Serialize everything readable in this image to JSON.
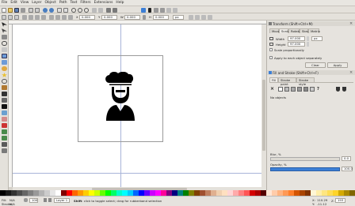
{
  "menu": [
    "File",
    "Edit",
    "View",
    "Layer",
    "Object",
    "Path",
    "Text",
    "Filters",
    "Extensions",
    "Help"
  ],
  "toolbar": {
    "x_label": "X",
    "x_value": "0.000",
    "y_label": "Y",
    "y_value": "0.000",
    "w_label": "W",
    "w_value": "0.000",
    "h_label": "H",
    "h_value": "0.000",
    "unit": "px"
  },
  "transform_panel": {
    "title": "Transform (Shift+Ctrl+M)",
    "tabs": [
      "Move",
      "Scale",
      "Rotate",
      "Skew",
      "Matrix"
    ],
    "active_tab": "Scale",
    "width_label": "Width",
    "width_value": "97.000",
    "height_label": "Height",
    "height_value": "97.000",
    "unit": "px",
    "scale_proportionally": "Scale proportionally",
    "apply_separately": "Apply to each object separately",
    "clear": "Clear",
    "apply": "Apply"
  },
  "fill_stroke_panel": {
    "title": "Fill and Stroke (Shift+Ctrl+F)",
    "tabs": [
      "Fill",
      "Stroke paint",
      "Stroke style"
    ],
    "active_tab": "Fill",
    "message": "No objects",
    "x_mark": "×",
    "question_mark": "?",
    "blur_label": "Blur, %",
    "blur_value": "0.0",
    "opacity_label": "Opacity, %",
    "opacity_value": "100.0"
  },
  "status": {
    "fill_label": "Fill:",
    "fill_value": "N/A",
    "stroke_label": "Stroke:",
    "stroke_value": "N/A",
    "opacity_value": "100",
    "layer": "Layer 1",
    "message_bold": "Shift",
    "message_rest": ": click to toggle select; drag for rubberband selection",
    "x_label": "X:",
    "x_value": "110.29",
    "y_label": "Y:",
    "y_value": "-11.12",
    "zoom_label": "Z:",
    "zoom_value": "193"
  },
  "colors": {
    "accent": "#3c7fd6",
    "palette": [
      "#000000",
      "#1a1a1a",
      "#333333",
      "#4d4d4d",
      "#666666",
      "#808080",
      "#999999",
      "#b3b3b3",
      "#cccccc",
      "#e6e6e6",
      "#ffffff",
      "#800000",
      "#ff0000",
      "#ff6600",
      "#ff9900",
      "#ffcc00",
      "#ffff00",
      "#ccff00",
      "#66ff00",
      "#00ff00",
      "#00ff66",
      "#00ffcc",
      "#00ffff",
      "#00ccff",
      "#0066ff",
      "#0000ff",
      "#6600ff",
      "#cc00ff",
      "#ff00ff",
      "#ff0099",
      "#800080",
      "#000080",
      "#008080",
      "#008000",
      "#808000",
      "#804000",
      "#a05030",
      "#c08060",
      "#e0b090",
      "#f0d0b0",
      "#ffe0c0",
      "#ffd5d5",
      "#ffaaaa",
      "#ff8080",
      "#ff5555",
      "#d40000",
      "#aa0000",
      "#550000",
      "#ffe6d5",
      "#ffccaa",
      "#ffb380",
      "#ff9955",
      "#ff7f2a",
      "#d45500",
      "#aa4400",
      "#803300",
      "#fff6d5",
      "#ffeeaa",
      "#ffe680",
      "#ffdd55",
      "#ffd42a",
      "#d4aa00",
      "#aa8800",
      "#806600"
    ]
  }
}
